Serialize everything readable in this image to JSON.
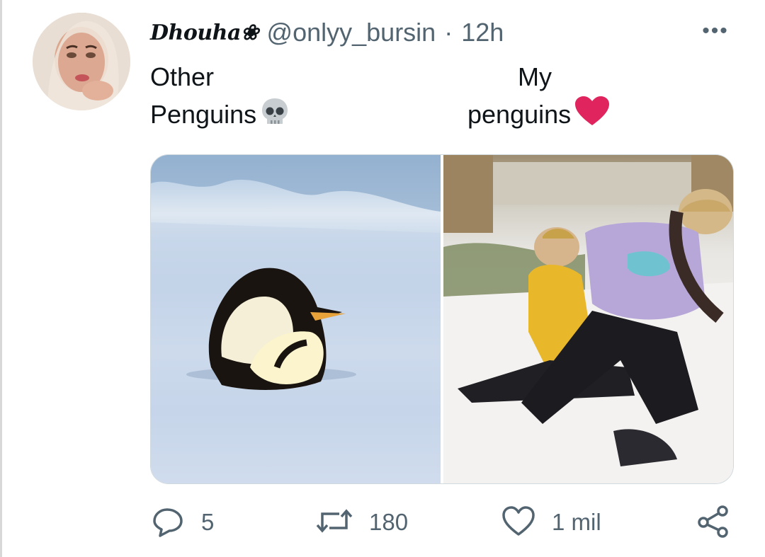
{
  "tweet": {
    "display_name": "Dhouha❀",
    "handle": "@onlyy_bursin",
    "separator": "·",
    "time": "12h",
    "more_label": "•••",
    "left_line1": "Other",
    "left_line2": "Penguins",
    "left_emoji": "skull-emoji",
    "right_line1": "My",
    "right_line2": "penguins",
    "right_emoji": "red-heart-emoji"
  },
  "media": {
    "left_image": "emperor-penguins-on-snow-photo",
    "right_image": "couple-playing-in-snow-photo"
  },
  "actions": {
    "reply_count": "5",
    "retweet_count": "180",
    "like_count": "1 mil",
    "icons": [
      "reply-icon",
      "retweet-icon",
      "like-icon",
      "share-icon"
    ]
  },
  "colors": {
    "text": "#0f1419",
    "secondary": "#536471",
    "heart": "#e0245e"
  }
}
